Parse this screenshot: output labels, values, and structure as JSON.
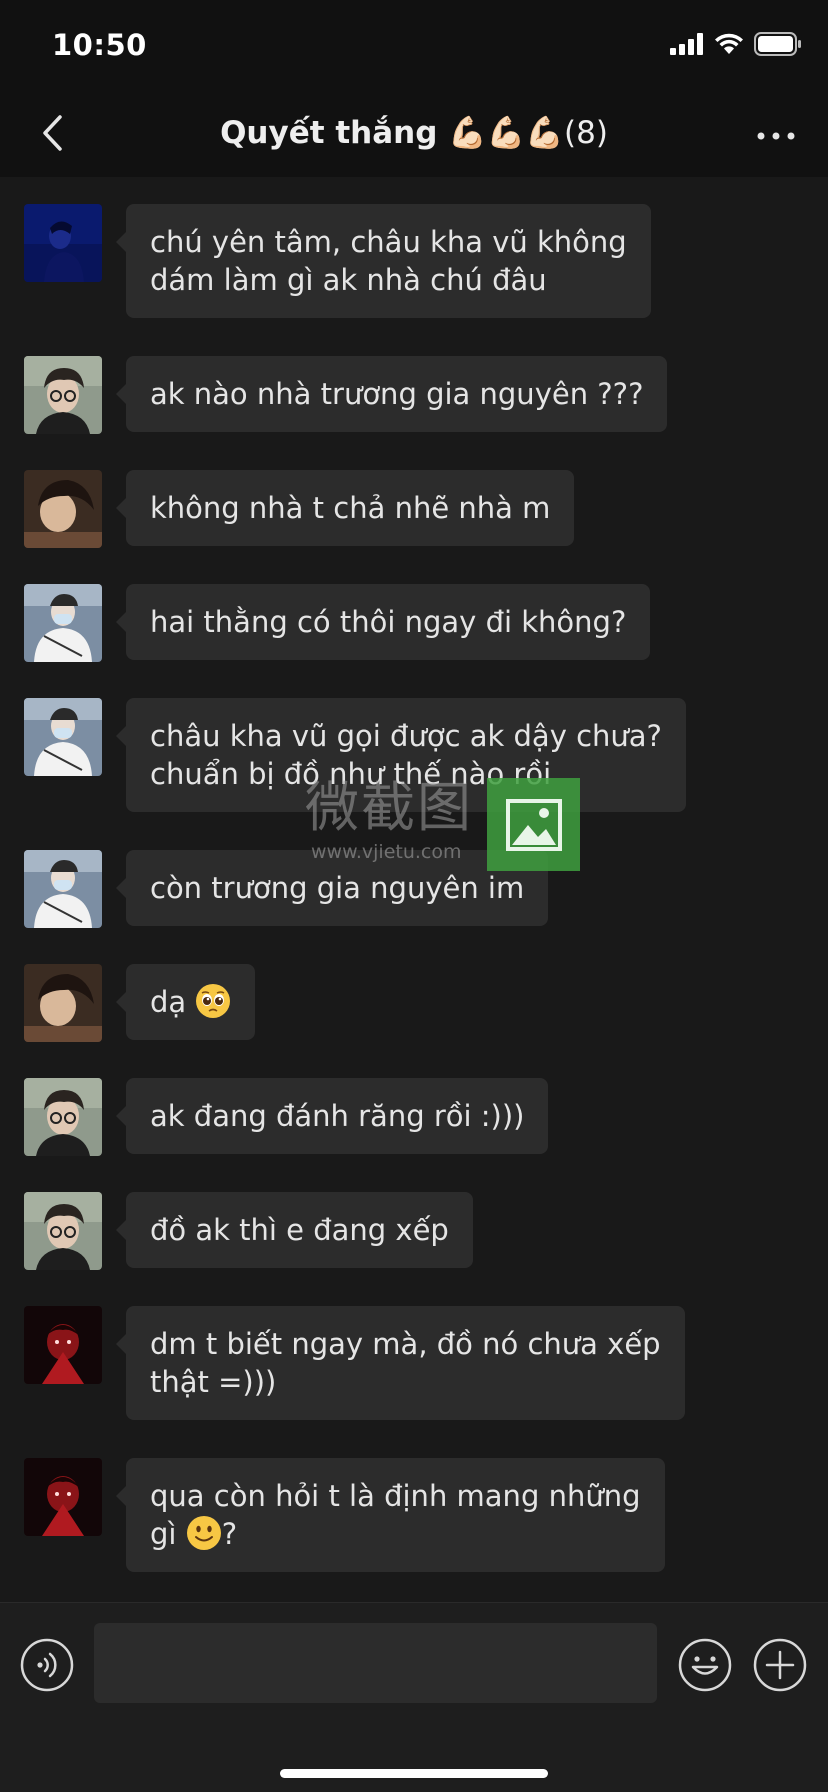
{
  "status_bar": {
    "time": "10:50",
    "icons": [
      "cellular-signal-icon",
      "wifi-icon",
      "battery-icon"
    ]
  },
  "nav": {
    "back_icon": "chevron-left-icon",
    "title": "Quyết thắng 💪🏻💪🏻💪🏻",
    "member_count": "(8)",
    "more_icon": "more-dots-icon"
  },
  "messages": [
    {
      "avatar": "avatar-blue-portrait",
      "text_lines": [
        "chú yên tâm, châu kha vũ không",
        "dám làm gì ak nhà chú đâu"
      ]
    },
    {
      "avatar": "avatar-glasses",
      "text_lines": [
        "ak nào nhà trương gia nguyên ???"
      ]
    },
    {
      "avatar": "avatar-side-profile",
      "text_lines": [
        "không nhà t chả nhẽ nhà m"
      ]
    },
    {
      "avatar": "avatar-white-jacket",
      "text_lines": [
        "hai thằng có thôi ngay đi không?"
      ]
    },
    {
      "avatar": "avatar-white-jacket",
      "text_lines": [
        "châu kha vũ gọi được ak dậy chưa?",
        "chuẩn bị đồ như thế nào rồi"
      ]
    },
    {
      "avatar": "avatar-white-jacket",
      "text_lines": [
        "còn trương gia nguyên im"
      ]
    },
    {
      "avatar": "avatar-side-profile",
      "text": "dạ",
      "emoji": "pleading-face-emoji"
    },
    {
      "avatar": "avatar-glasses",
      "text_lines": [
        "ak đang đánh răng rồi :)))"
      ]
    },
    {
      "avatar": "avatar-glasses",
      "text_lines": [
        "đồ ak thì e đang xếp"
      ]
    },
    {
      "avatar": "avatar-red-dark",
      "text_lines": [
        "dm t biết ngay mà, đồ nó chưa xếp",
        "thật =)))"
      ]
    },
    {
      "avatar": "avatar-red-dark",
      "line1": "qua còn hỏi t là định mang những",
      "line2_text": "gì ",
      "line2_suffix": "?",
      "emoji": "slightly-smiling-face-emoji"
    }
  ],
  "watermark": {
    "text": "微截图",
    "url": "www.vjietu.com"
  },
  "input_bar": {
    "voice_icon": "voice-input-icon",
    "input_value": "",
    "emoji_icon": "emoji-smiley-icon",
    "add_icon": "plus-circle-icon"
  }
}
